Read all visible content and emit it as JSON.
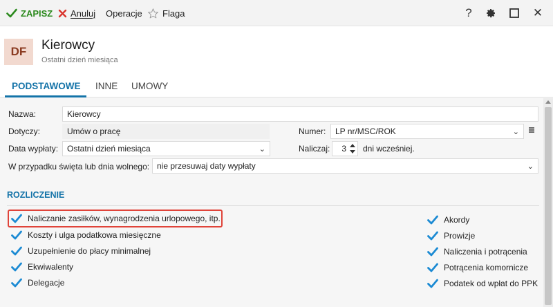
{
  "toolbar": {
    "save_label": "ZAPISZ",
    "cancel_label": "Anuluj",
    "operations_label": "Operacje",
    "flag_label": "Flaga"
  },
  "window_controls": {
    "help": "?",
    "settings_icon": "gear-icon",
    "maximize_icon": "square-icon",
    "close": "✕"
  },
  "header": {
    "avatar": "DF",
    "title": "Kierowcy",
    "subtitle": "Ostatni dzień miesiąca"
  },
  "tabs": [
    {
      "label": "PODSTAWOWE",
      "active": true
    },
    {
      "label": "INNE",
      "active": false
    },
    {
      "label": "UMOWY",
      "active": false
    }
  ],
  "form": {
    "name_label": "Nazwa:",
    "name_value": "Kierowcy",
    "applies_label": "Dotyczy:",
    "applies_value": "Umów o pracę",
    "number_label": "Numer:",
    "number_value": "LP nr/MSC/ROK",
    "payout_label": "Data wypłaty:",
    "payout_value": "Ostatni dzień miesiąca",
    "accrue_label": "Naliczaj:",
    "accrue_value": "3",
    "accrue_suffix": "dni wcześniej.",
    "holiday_label": "W przypadku święta lub dnia wolnego:",
    "holiday_value": "nie przesuwaj daty wypłaty"
  },
  "settlement": {
    "heading": "ROZLICZENIE",
    "left": [
      {
        "label": "Naliczanie zasiłków, wynagrodzenia urlopowego, itp.",
        "checked": true
      },
      {
        "label": "Koszty i ulga podatkowa miesięczne",
        "checked": true
      },
      {
        "label": "Uzupełnienie do płacy minimalnej",
        "checked": true
      },
      {
        "label": "Ekwiwalenty",
        "checked": true
      },
      {
        "label": "Delegacje",
        "checked": true
      }
    ],
    "right": [
      {
        "label": "Akordy",
        "checked": true
      },
      {
        "label": "Prowizje",
        "checked": true
      },
      {
        "label": "Naliczenia i potrącenia",
        "checked": true
      },
      {
        "label": "Potrącenia komornicze",
        "checked": true
      },
      {
        "label": "Podatek od wpłat do PPK",
        "checked": true
      }
    ]
  },
  "colors": {
    "accent": "#1473a8",
    "check": "#1b8ad3",
    "save": "#2c8a1e",
    "cancel": "#d9322b",
    "highlight": "#e0443a"
  }
}
